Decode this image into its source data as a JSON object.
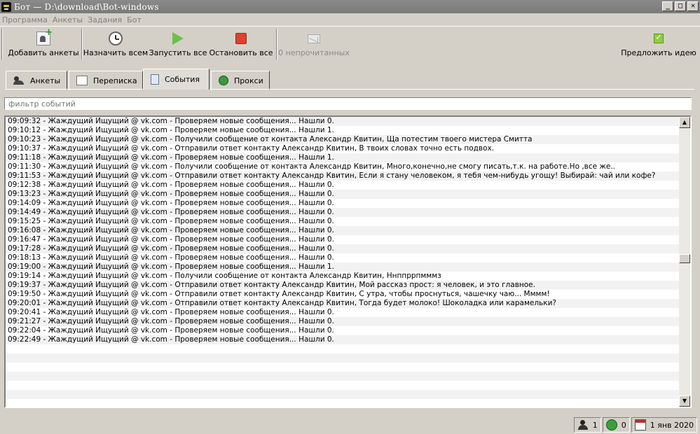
{
  "window": {
    "title": "Бот — D:\\download\\Bot-windows",
    "minimize": "_",
    "maximize": "□",
    "close": "✕"
  },
  "menu": [
    "Программа",
    "Анкеты",
    "Задания",
    "Бот"
  ],
  "toolbar": {
    "add_profiles": "Добавить анкеты",
    "assign_all": "Назначить всем",
    "start_all": "Запустить все",
    "stop_all": "Остановить все",
    "unread": "0 непрочитанных",
    "suggest_idea": "Предложить идею"
  },
  "tabs": [
    {
      "label": "Анкеты",
      "icon": "users-icon"
    },
    {
      "label": "Переписка",
      "icon": "chat-icon"
    },
    {
      "label": "События",
      "icon": "events-icon",
      "active": true
    },
    {
      "label": "Прокси",
      "icon": "proxy-icon"
    }
  ],
  "filter": {
    "placeholder": "фильтр событий"
  },
  "log": [
    "09:09:32 - Жаждущий Ищущий @ vk.com - Проверяем новые сообщения... Нашли 0.",
    "09:10:12 - Жаждущий Ищущий @ vk.com - Проверяем новые сообщения... Нашли 1.",
    "09:10:23 - Жаждущий Ищущий @ vk.com - Получили сообщение от контакта Александр Квитин, Ща потестим твоего мистера Смитта",
    "09:10:37 - Жаждущий Ищущий @ vk.com - Отправили ответ контакту Александр Квитин, В твоих словах точно есть подвох.",
    "09:11:18 - Жаждущий Ищущий @ vk.com - Проверяем новые сообщения... Нашли 1.",
    "09:11:30 - Жаждущий Ищущий @ vk.com - Получили сообщение от контакта Александр Квитин, Много,конечно,не смогу писать,т.к. на работе.Но ,все же..",
    "09:11:53 - Жаждущий Ищущий @ vk.com - Отправили ответ контакту Александр Квитин, Если я стану человеком, я тебя чем-нибудь угощу! Выбирай: чай или кофе?",
    "09:12:38 - Жаждущий Ищущий @ vk.com - Проверяем новые сообщения... Нашли 0.",
    "09:13:23 - Жаждущий Ищущий @ vk.com - Проверяем новые сообщения... Нашли 0.",
    "09:14:09 - Жаждущий Ищущий @ vk.com - Проверяем новые сообщения... Нашли 0.",
    "09:14:49 - Жаждущий Ищущий @ vk.com - Проверяем новые сообщения... Нашли 0.",
    "09:15:25 - Жаждущий Ищущий @ vk.com - Проверяем новые сообщения... Нашли 0.",
    "09:16:08 - Жаждущий Ищущий @ vk.com - Проверяем новые сообщения... Нашли 0.",
    "09:16:47 - Жаждущий Ищущий @ vk.com - Проверяем новые сообщения... Нашли 0.",
    "09:17:28 - Жаждущий Ищущий @ vk.com - Проверяем новые сообщения... Нашли 0.",
    "09:18:13 - Жаждущий Ищущий @ vk.com - Проверяем новые сообщения... Нашли 0.",
    "09:19:00 - Жаждущий Ищущий @ vk.com - Проверяем новые сообщения... Нашли 1.",
    "09:19:14 - Жаждущий Ищущий @ vk.com - Получили сообщение от контакта Александр Квитин, Ннппррпмммз",
    "09:19:37 - Жаждущий Ищущий @ vk.com - Отправили ответ контакту Александр Квитин, Мой рассказ прост: я человек, и это главное.",
    "09:19:50 - Жаждущий Ищущий @ vk.com - Отправили ответ контакту Александр Квитин, С утра, чтобы проснуться, чашечку чаю... Мммм!",
    "09:20:01 - Жаждущий Ищущий @ vk.com - Отправили ответ контакту Александр Квитин, Тогда будет молоко! Шоколадка или карамельки?",
    "09:20:41 - Жаждущий Ищущий @ vk.com - Проверяем новые сообщения... Нашли 0.",
    "09:21:27 - Жаждущий Ищущий @ vk.com - Проверяем новые сообщения... Нашли 0.",
    "09:22:04 - Жаждущий Ищущий @ vk.com - Проверяем новые сообщения... Нашли 0.",
    "09:22:49 - Жаждущий Ищущий @ vk.com - Проверяем новые сообщения... Нашли 0."
  ],
  "scrollbar": {
    "up": "▲",
    "down": "▼"
  },
  "status": {
    "users_count": "1",
    "proxy_count": "0",
    "date": "1 янв 2020"
  }
}
